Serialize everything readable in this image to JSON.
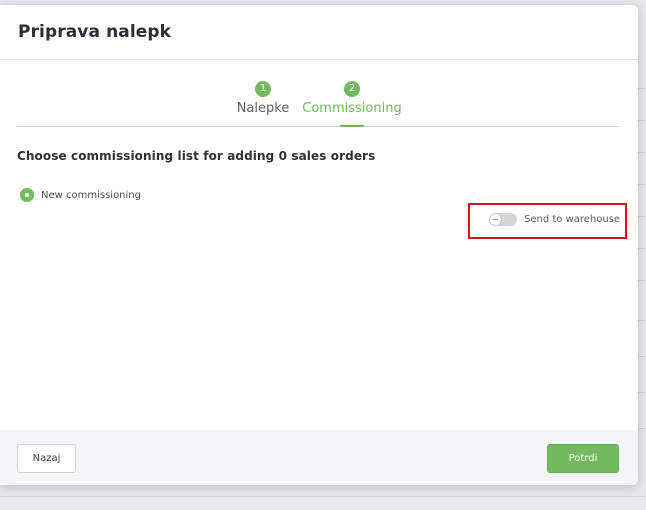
{
  "modal": {
    "title": "Priprava nalepk"
  },
  "stepper": {
    "steps": [
      {
        "number": "1",
        "label": "Nalepke",
        "active": false
      },
      {
        "number": "2",
        "label": "Commissioning",
        "active": true
      }
    ]
  },
  "content": {
    "heading": "Choose commissioning list for adding 0 sales orders",
    "radio_option_label": "New commissioning",
    "toggle_label": "Send to warehouse",
    "toggle_on": false
  },
  "footer": {
    "back_label": "Nazaj",
    "confirm_label": "Potrdi"
  },
  "colors": {
    "accent": "#73b95f",
    "highlight": "#d8131b"
  }
}
